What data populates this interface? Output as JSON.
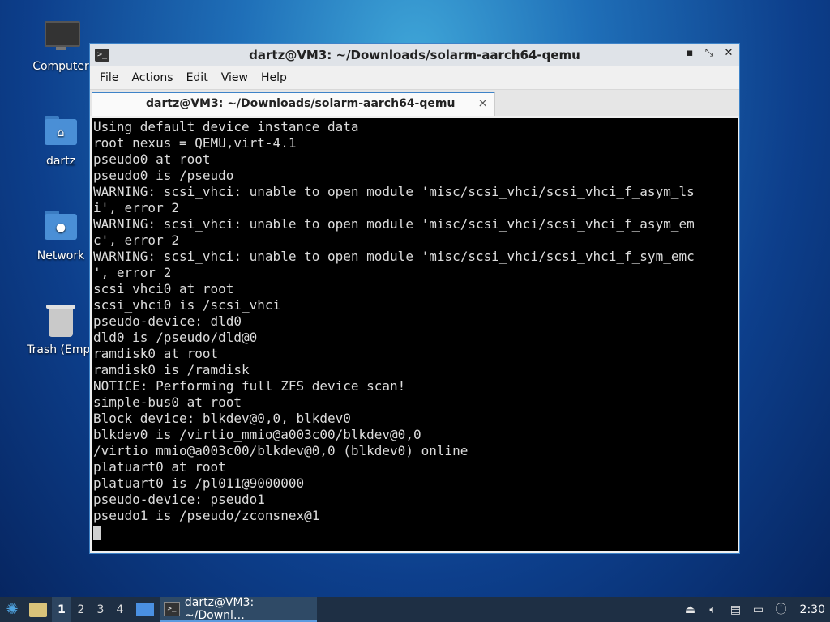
{
  "desktop": {
    "icons": [
      {
        "label": "Computer",
        "icon": "computer-icon"
      },
      {
        "label": "dartz",
        "icon": "home-folder-icon"
      },
      {
        "label": "Network",
        "icon": "network-folder-icon"
      },
      {
        "label": "Trash (Empt",
        "icon": "trash-icon"
      }
    ]
  },
  "window": {
    "title": "dartz@VM3: ~/Downloads/solarm-aarch64-qemu",
    "controls": {
      "minimize": "▪",
      "maximize": "⤡",
      "close": "✕"
    },
    "menu": [
      "File",
      "Actions",
      "Edit",
      "View",
      "Help"
    ],
    "tab": {
      "label": "dartz@VM3: ~/Downloads/solarm-aarch64-qemu",
      "close": "×"
    }
  },
  "terminal": {
    "lines": [
      "Using default device instance data",
      "root nexus = QEMU,virt-4.1",
      "pseudo0 at root",
      "pseudo0 is /pseudo",
      "WARNING: scsi_vhci: unable to open module 'misc/scsi_vhci/scsi_vhci_f_asym_ls",
      "i', error 2",
      "WARNING: scsi_vhci: unable to open module 'misc/scsi_vhci/scsi_vhci_f_asym_em",
      "c', error 2",
      "WARNING: scsi_vhci: unable to open module 'misc/scsi_vhci/scsi_vhci_f_sym_emc",
      "', error 2",
      "scsi_vhci0 at root",
      "scsi_vhci0 is /scsi_vhci",
      "pseudo-device: dld0",
      "dld0 is /pseudo/dld@0",
      "ramdisk0 at root",
      "ramdisk0 is /ramdisk",
      "NOTICE: Performing full ZFS device scan!",
      "simple-bus0 at root",
      "Block device: blkdev@0,0, blkdev0",
      "blkdev0 is /virtio_mmio@a003c00/blkdev@0,0",
      "/virtio_mmio@a003c00/blkdev@0,0 (blkdev0) online",
      "platuart0 at root",
      "platuart0 is /pl011@9000000",
      "pseudo-device: pseudo1",
      "pseudo1 is /pseudo/zconsnex@1"
    ]
  },
  "taskbar": {
    "workspaces": [
      "1",
      "2",
      "3",
      "4"
    ],
    "active_workspace": "1",
    "task_label": "dartz@VM3: ~/Downl…",
    "clock": "2:30"
  }
}
